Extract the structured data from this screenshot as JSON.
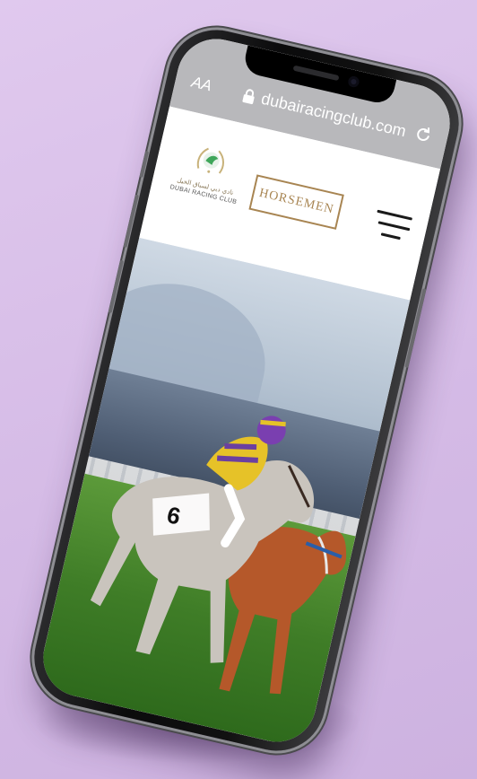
{
  "browser": {
    "text_size_label": "AA",
    "url": "dubairacingclub.com",
    "lock_icon": "lock-icon",
    "reload_icon": "reload-icon"
  },
  "header": {
    "logo": {
      "arabic_name": "نادي دبي لسباق الخيل",
      "english_name": "DUBAI RACING CLUB"
    },
    "horsemen_button": "HORSEMEN",
    "menu_icon": "hamburger-menu-icon"
  },
  "hero": {
    "image": "racehorses-on-turf-photo"
  },
  "colors": {
    "background": "#dbc3ea",
    "gold_accent": "#a88552",
    "browser_bar": "#b8b8bb",
    "grass": "#3f7d27"
  }
}
